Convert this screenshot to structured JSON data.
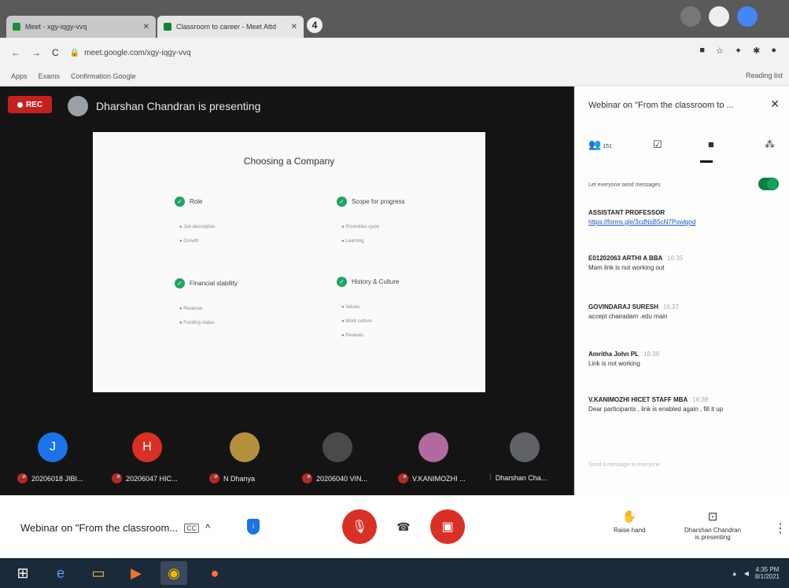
{
  "browser": {
    "tabs": [
      {
        "label": "Meet - xgy-iqgy-vvq"
      },
      {
        "label": "Classroom to career - Meet Attd"
      }
    ],
    "tab_count": "4",
    "nav": {
      "back": "←",
      "forward": "→",
      "reload": "C"
    },
    "url": "meet.google.com/xgy-iqgy-vvq",
    "bookmarks": [
      "Apps",
      "Exams",
      "Confirmation Google"
    ],
    "reading_list": "Reading list"
  },
  "meet": {
    "rec_label": "REC",
    "presenting_text": "Dharshan Chandran is presenting",
    "slide": {
      "title": "Choosing a Company",
      "sections": [
        {
          "label": "Role",
          "bullets": [
            "● Job description",
            "● Growth"
          ]
        },
        {
          "label": "Scope for progress",
          "bullets": [
            "● Promotion cycle",
            "● Learning"
          ]
        },
        {
          "label": "Financial stability",
          "bullets": [
            "● Revenue",
            "● Funding status"
          ]
        },
        {
          "label": "History & Culture",
          "bullets": [
            "● Values",
            "● Work culture",
            "● Reviews"
          ]
        }
      ]
    },
    "participants": [
      {
        "initial": "J",
        "name": "20206018 JIBI...",
        "color": "#1a73e8"
      },
      {
        "initial": "H",
        "name": "20206047 HIC...",
        "color": "#d93025"
      },
      {
        "initial": "",
        "name": "N Dhanya",
        "color": "#b5903c"
      },
      {
        "initial": "",
        "name": "20206040 VIN...",
        "color": "#4a4a4a"
      },
      {
        "initial": "",
        "name": "V.KANIMOZHI ...",
        "color": "#b06aa0"
      },
      {
        "initial": "",
        "name": "Dharshan Cha...",
        "color": "#5f6368"
      }
    ]
  },
  "panel": {
    "title": "Webinar on \"From the classroom to ...",
    "close": "✕",
    "tabs": [
      {
        "icon": "people-icon",
        "glyph": "👥",
        "count": "151"
      },
      {
        "icon": "checklist-icon",
        "glyph": "☑"
      },
      {
        "icon": "chat-icon",
        "glyph": "■"
      },
      {
        "icon": "activities-icon",
        "glyph": "⁂"
      }
    ],
    "toggle_label": "Let everyone send messages",
    "messages": [
      {
        "sender": "ASSISTANT PROFESSOR",
        "time": "",
        "body": "https://forms.gle/3cdNsB5cN7Powlqnd",
        "link": true
      },
      {
        "sender": "E01202063 ARTHI A BBA",
        "time": "16:35",
        "body": "Mam link is not working out",
        "link": false
      },
      {
        "sender": "GOVINDARAJ SURESH",
        "time": "16:37",
        "body": "accept chairadam .edu main",
        "link": false
      },
      {
        "sender": "Amritha John PL",
        "time": "16:39",
        "body": "Link is not working",
        "link": false
      },
      {
        "sender": "V.KANIMOZHI HICET STAFF MBA",
        "time": "16:39",
        "body": "Dear participants , link is enabled again , fill it up",
        "link": false
      }
    ],
    "send_placeholder": "Send a message to everyone"
  },
  "bottom": {
    "meeting_title": "Webinar on \"From the classroom...",
    "cc": "CC",
    "raise_hand": "Raise hand",
    "presenter_line1": "Dharshan Chandran",
    "presenter_line2": "is presenting",
    "more": "⋮"
  },
  "taskbar": {
    "time": "4:35 PM",
    "date": "8/1/2021"
  }
}
